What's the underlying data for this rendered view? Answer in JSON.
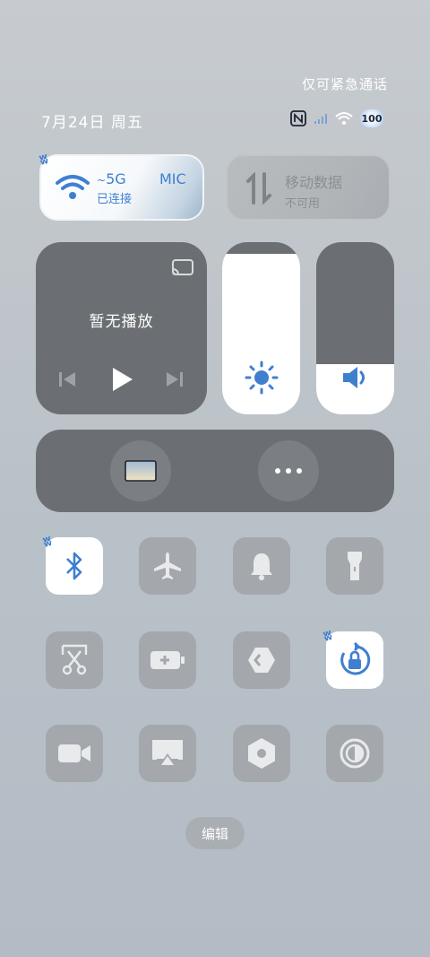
{
  "status_bar": {
    "emergency_text": "仅可紧急通话",
    "date_text": "7月24日 周五",
    "battery_level": "100",
    "icons": [
      "nfc-icon",
      "signal-icon",
      "wifi-icon",
      "battery-icon"
    ]
  },
  "tiles": {
    "wifi": {
      "network_band": "5G",
      "network_name": "MIC",
      "status": "已连接",
      "active": true
    },
    "mobile_data": {
      "title": "移动数据",
      "status": "不可用",
      "active": false
    }
  },
  "media": {
    "status_text": "暂无播放"
  },
  "sliders": {
    "brightness_level": 0.93,
    "volume_level": 0.29
  },
  "quick_toggles": [
    {
      "name": "bluetooth",
      "icon": "bluetooth-icon",
      "active": true
    },
    {
      "name": "airplane-mode",
      "icon": "airplane-icon",
      "active": false
    },
    {
      "name": "ringer",
      "icon": "bell-icon",
      "active": false
    },
    {
      "name": "flashlight",
      "icon": "flashlight-icon",
      "active": false
    },
    {
      "name": "screenshot",
      "icon": "scissors-icon",
      "active": false
    },
    {
      "name": "battery-saver",
      "icon": "battery-plus-icon",
      "active": false
    },
    {
      "name": "developer-shortcut",
      "icon": "code-arrow-icon",
      "active": false
    },
    {
      "name": "rotation-lock",
      "icon": "rotation-lock-icon",
      "active": true
    },
    {
      "name": "screen-record",
      "icon": "video-camera-icon",
      "active": false
    },
    {
      "name": "screen-cast",
      "icon": "airplay-icon",
      "active": false
    },
    {
      "name": "settings",
      "icon": "hexagon-nut-icon",
      "active": false
    },
    {
      "name": "dark-mode",
      "icon": "contrast-icon",
      "active": false
    }
  ],
  "edit_label": "编辑",
  "colors": {
    "accent": "#3f7fd0",
    "panel_dark": "#6b6f73",
    "tile_off": "#a4a8ac"
  }
}
